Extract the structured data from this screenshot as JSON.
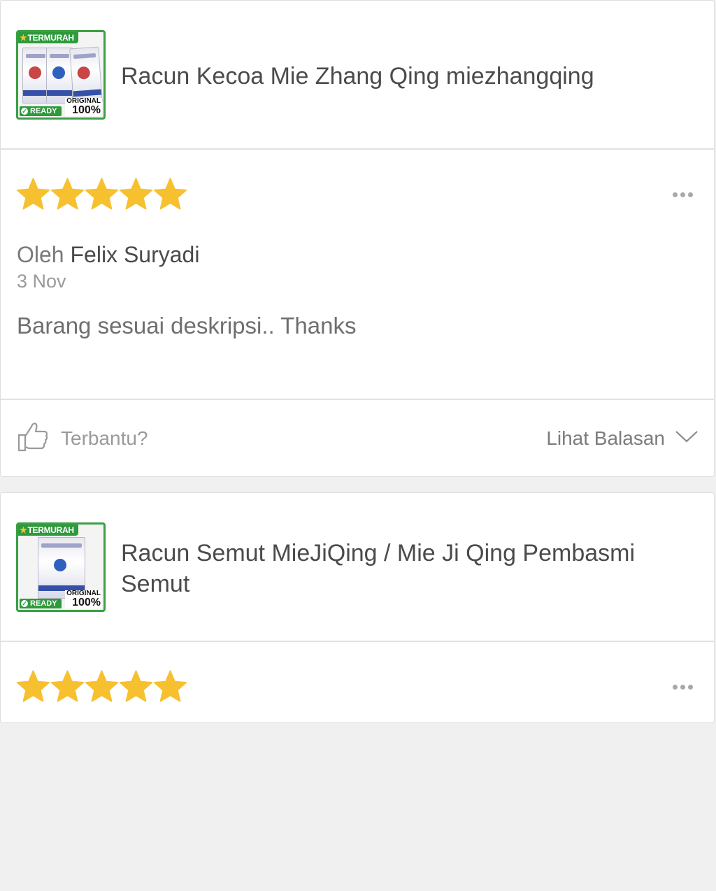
{
  "colors": {
    "star": "#f7c02f",
    "badge_green": "#2e9a3c",
    "text": "#4a4a4a"
  },
  "reviews": [
    {
      "product": {
        "title": "Racun Kecoa Mie Zhang Qing miezhangqing",
        "badge_top": "TERMURAH",
        "badge_ready": "READY",
        "badge_original": "ORIGINAL",
        "badge_percent": "100%"
      },
      "rating": 5,
      "by_prefix": "Oleh",
      "reviewer": "Felix Suryadi",
      "date": "3 Nov",
      "comment": "Barang sesuai deskripsi.. Thanks",
      "helpful_label": "Terbantu?",
      "see_replies_label": "Lihat Balasan"
    },
    {
      "product": {
        "title": "Racun Semut MieJiQing / Mie Ji Qing Pembasmi Semut",
        "badge_top": "TERMURAH",
        "badge_ready": "READY",
        "badge_original": "ORIGINAL",
        "badge_percent": "100%"
      },
      "rating": 5
    }
  ],
  "icons": {
    "more": "ellipsis-icon",
    "helpful": "thumbs-up-icon",
    "expand": "chevron-down-icon",
    "rating": "star-icon"
  }
}
